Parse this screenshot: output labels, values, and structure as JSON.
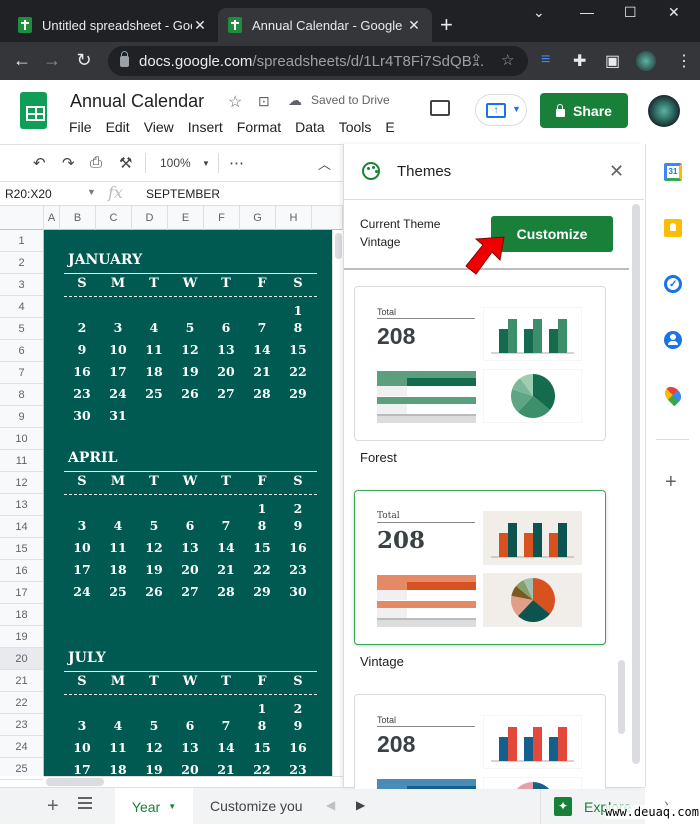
{
  "browser": {
    "tabs": [
      {
        "title": "Untitled spreadsheet - Goog",
        "active": false
      },
      {
        "title": "Annual Calendar - Google S",
        "active": true
      }
    ],
    "new_tab": "+",
    "window_controls": {
      "dropdown": "⌄",
      "minimize": "—",
      "maximize": "☐",
      "close": "✕"
    },
    "url_host": "docs.google.com",
    "url_path": "/spreadsheets/d/1Lr4T8Fi7SdQB..."
  },
  "app": {
    "title": "Annual Calendar",
    "saved_status": "Saved to Drive",
    "menu": [
      "File",
      "Edit",
      "View",
      "Insert",
      "Format",
      "Data",
      "Tools",
      "E"
    ],
    "share_label": "Share",
    "brand_color": "#188038"
  },
  "toolbar": {
    "zoom": "100%",
    "more": "⋯"
  },
  "formula_bar": {
    "name_box": "R20:X20",
    "fx": "fx",
    "value": "SEPTEMBER"
  },
  "grid": {
    "columns": [
      "A",
      "B",
      "C",
      "D",
      "E",
      "F",
      "G",
      "H"
    ],
    "rows": [
      "1",
      "2",
      "3",
      "4",
      "5",
      "6",
      "7",
      "8",
      "9",
      "10",
      "11",
      "12",
      "13",
      "14",
      "15",
      "16",
      "17",
      "18",
      "19",
      "20",
      "21",
      "22",
      "23",
      "24",
      "25"
    ],
    "selected_row": "20"
  },
  "calendar": {
    "bg_color": "#005a51",
    "weekdays": [
      "S",
      "M",
      "T",
      "W",
      "T",
      "F",
      "S"
    ],
    "months": [
      {
        "name": "JANUARY",
        "weeks": [
          [
            "",
            "",
            "",
            "",
            "",
            "",
            "1"
          ],
          [
            "2",
            "3",
            "4",
            "5",
            "6",
            "7",
            "8"
          ],
          [
            "9",
            "10",
            "11",
            "12",
            "13",
            "14",
            "15"
          ],
          [
            "16",
            "17",
            "18",
            "19",
            "20",
            "21",
            "22"
          ],
          [
            "23",
            "24",
            "25",
            "26",
            "27",
            "28",
            "29"
          ],
          [
            "30",
            "31",
            "",
            "",
            "",
            "",
            ""
          ]
        ]
      },
      {
        "name": "APRIL",
        "weeks": [
          [
            "",
            "",
            "",
            "",
            "",
            "1",
            "2"
          ],
          [
            "3",
            "4",
            "5",
            "6",
            "7",
            "8",
            "9"
          ],
          [
            "10",
            "11",
            "12",
            "13",
            "14",
            "15",
            "16"
          ],
          [
            "17",
            "18",
            "19",
            "20",
            "21",
            "22",
            "23"
          ],
          [
            "24",
            "25",
            "26",
            "27",
            "28",
            "29",
            "30"
          ]
        ]
      },
      {
        "name": "JULY",
        "weeks": [
          [
            "",
            "",
            "",
            "",
            "",
            "1",
            "2"
          ],
          [
            "3",
            "4",
            "5",
            "6",
            "7",
            "8",
            "9"
          ],
          [
            "10",
            "11",
            "12",
            "13",
            "14",
            "15",
            "16"
          ],
          [
            "17",
            "18",
            "19",
            "20",
            "21",
            "22",
            "23"
          ]
        ]
      }
    ]
  },
  "sheets": {
    "tabs": [
      "Year",
      "Customize you"
    ],
    "active": "Year",
    "explore_label": "Explore"
  },
  "themes_panel": {
    "title": "Themes",
    "current_theme_label": "Current Theme",
    "current_theme": "Vintage",
    "customize_label": "Customize",
    "themes": [
      {
        "name": "Forest",
        "total_label": "Total",
        "total_value": "208",
        "selected": false,
        "colors": {
          "primary": "#156b4e",
          "secondary": "#3d8f6b",
          "light": "#5b9f7f",
          "pie": [
            "#156b4e",
            "#3d8f6b",
            "#5ea683",
            "#7bb898",
            "#9fcdb2"
          ]
        }
      },
      {
        "name": "Vintage",
        "total_label": "Total",
        "total_value": "208",
        "selected": true,
        "colors": {
          "primary": "#d7521f",
          "secondary": "#0d5450",
          "light": "#e48a66",
          "bg": "#f1ede8",
          "pie": [
            "#d7521f",
            "#0d5450",
            "#e19f88",
            "#7b5a1f",
            "#87a06b",
            "#a4c0b0"
          ]
        }
      },
      {
        "name": "",
        "total_label": "Total",
        "total_value": "208",
        "selected": false,
        "colors": {
          "primary": "#155f8c",
          "secondary": "#e2493b",
          "light": "#4a8cb8",
          "pie": [
            "#155f8c",
            "#e6c85a",
            "#e6a1a8"
          ]
        }
      }
    ]
  },
  "side_panel": {
    "apps": [
      "calendar-icon",
      "keep-icon",
      "tasks-icon",
      "contacts-icon",
      "maps-icon"
    ],
    "add": "+",
    "calendar_day": "31"
  },
  "watermark": "www.deuaq.com"
}
